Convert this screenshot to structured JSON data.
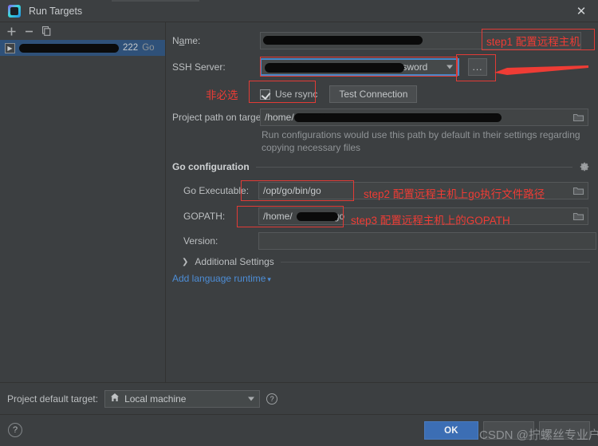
{
  "window": {
    "title": "Run Targets",
    "app_icon": "goland-icon",
    "close_icon": "close-icon"
  },
  "sidebar": {
    "toolbar": [
      {
        "name": "add-target-button",
        "icon": "plus-icon"
      },
      {
        "name": "remove-target-button",
        "icon": "minus-icon"
      },
      {
        "name": "copy-target-button",
        "icon": "copy-icon"
      }
    ],
    "items": [
      {
        "expander_icon": "chevron-right-icon",
        "host_redacted": "",
        "port": "222",
        "language": "Go",
        "selected": true
      }
    ]
  },
  "form": {
    "name_label": "Name:",
    "name_value": "",
    "ssh_server_label": "SSH Server:",
    "ssh_server_value": "password",
    "ssh_browse_label": "...",
    "optional_note": "非必选",
    "use_rsync_label": "Use rsync",
    "use_rsync_checked": true,
    "test_connection_label": "Test Connection",
    "project_path_label": "Project path on target:",
    "project_path_value": "/home/",
    "project_path_hint": "Run configurations would use this path by default in their settings regarding copying necessary files",
    "folder_icon": "folder-icon"
  },
  "go_section": {
    "title": "Go configuration",
    "gear_icon": "gear-icon",
    "go_executable_label": "Go Executable:",
    "go_executable_value": "/opt/go/bin/go",
    "gopath_label": "GOPATH:",
    "gopath_value_prefix": "/home/",
    "gopath_value_suffix": "go",
    "version_label": "Version:",
    "version_value": "",
    "additional_settings_label": "Additional Settings",
    "additional_settings_icon": "chevron-right-icon",
    "add_language_runtime_label": "Add language runtime",
    "add_language_runtime_caret": "chevron-down-icon"
  },
  "annotations": {
    "step1": "step1 配置远程主机",
    "step2": "step2 配置远程主机上go执行文件路径",
    "step3": "step3 配置远程主机上的GOPATH",
    "arrow_icon": "left-arrow-icon",
    "accent_color": "#ef3c35"
  },
  "footer": {
    "default_target_label": "Project default target:",
    "default_target_value": "Local machine",
    "default_target_icon": "home-icon",
    "default_target_help_icon": "help-icon",
    "help_icon": "help-icon",
    "ok_label": "OK",
    "cancel_label": "",
    "apply_label": "",
    "watermark": "CSDN @拧螺丝专业户"
  },
  "colors": {
    "background": "#3c3f41",
    "field_background": "#45494a",
    "selection": "#2f5179",
    "focus_border": "#4a88c7",
    "link": "#4d8dd6",
    "primary_button": "#3c6eb4",
    "annotation_red": "#ef3c35"
  }
}
